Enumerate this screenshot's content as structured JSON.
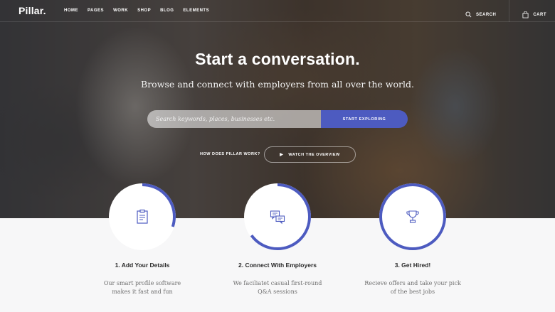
{
  "nav": {
    "logo": "Pillar.",
    "items": [
      "HOME",
      "PAGES",
      "WORK",
      "SHOP",
      "BLOG",
      "ELEMENTS"
    ],
    "search_label": "SEARCH",
    "cart_label": "CART"
  },
  "hero": {
    "title": "Start a conversation.",
    "subtitle": "Browse and connect with employers from all over the world.",
    "search_placeholder": "Search keywords, places, businesses etc.",
    "search_button": "START EXPLORING",
    "how_link": "HOW DOES PILLAR WORK?",
    "overview_button": "WATCH THE OVERVIEW"
  },
  "steps": [
    {
      "title": "1. Add Your Details",
      "desc_line1": "Our smart profile software",
      "desc_line2": "makes it fast and fun",
      "icon": "clipboard-icon",
      "progress": 0.3
    },
    {
      "title": "2. Connect With Employers",
      "desc_line1": "We faciliatet casual first-round",
      "desc_line2": "Q&A sessions",
      "icon": "chat-bubbles-icon",
      "progress": 0.65
    },
    {
      "title": "3. Get Hired!",
      "desc_line1": "Recieve offers and take your pick",
      "desc_line2": "of the best jobs",
      "icon": "trophy-icon",
      "progress": 1.0
    }
  ],
  "colors": {
    "accent": "#4d5bc0",
    "ring_track": "#ffffff"
  }
}
